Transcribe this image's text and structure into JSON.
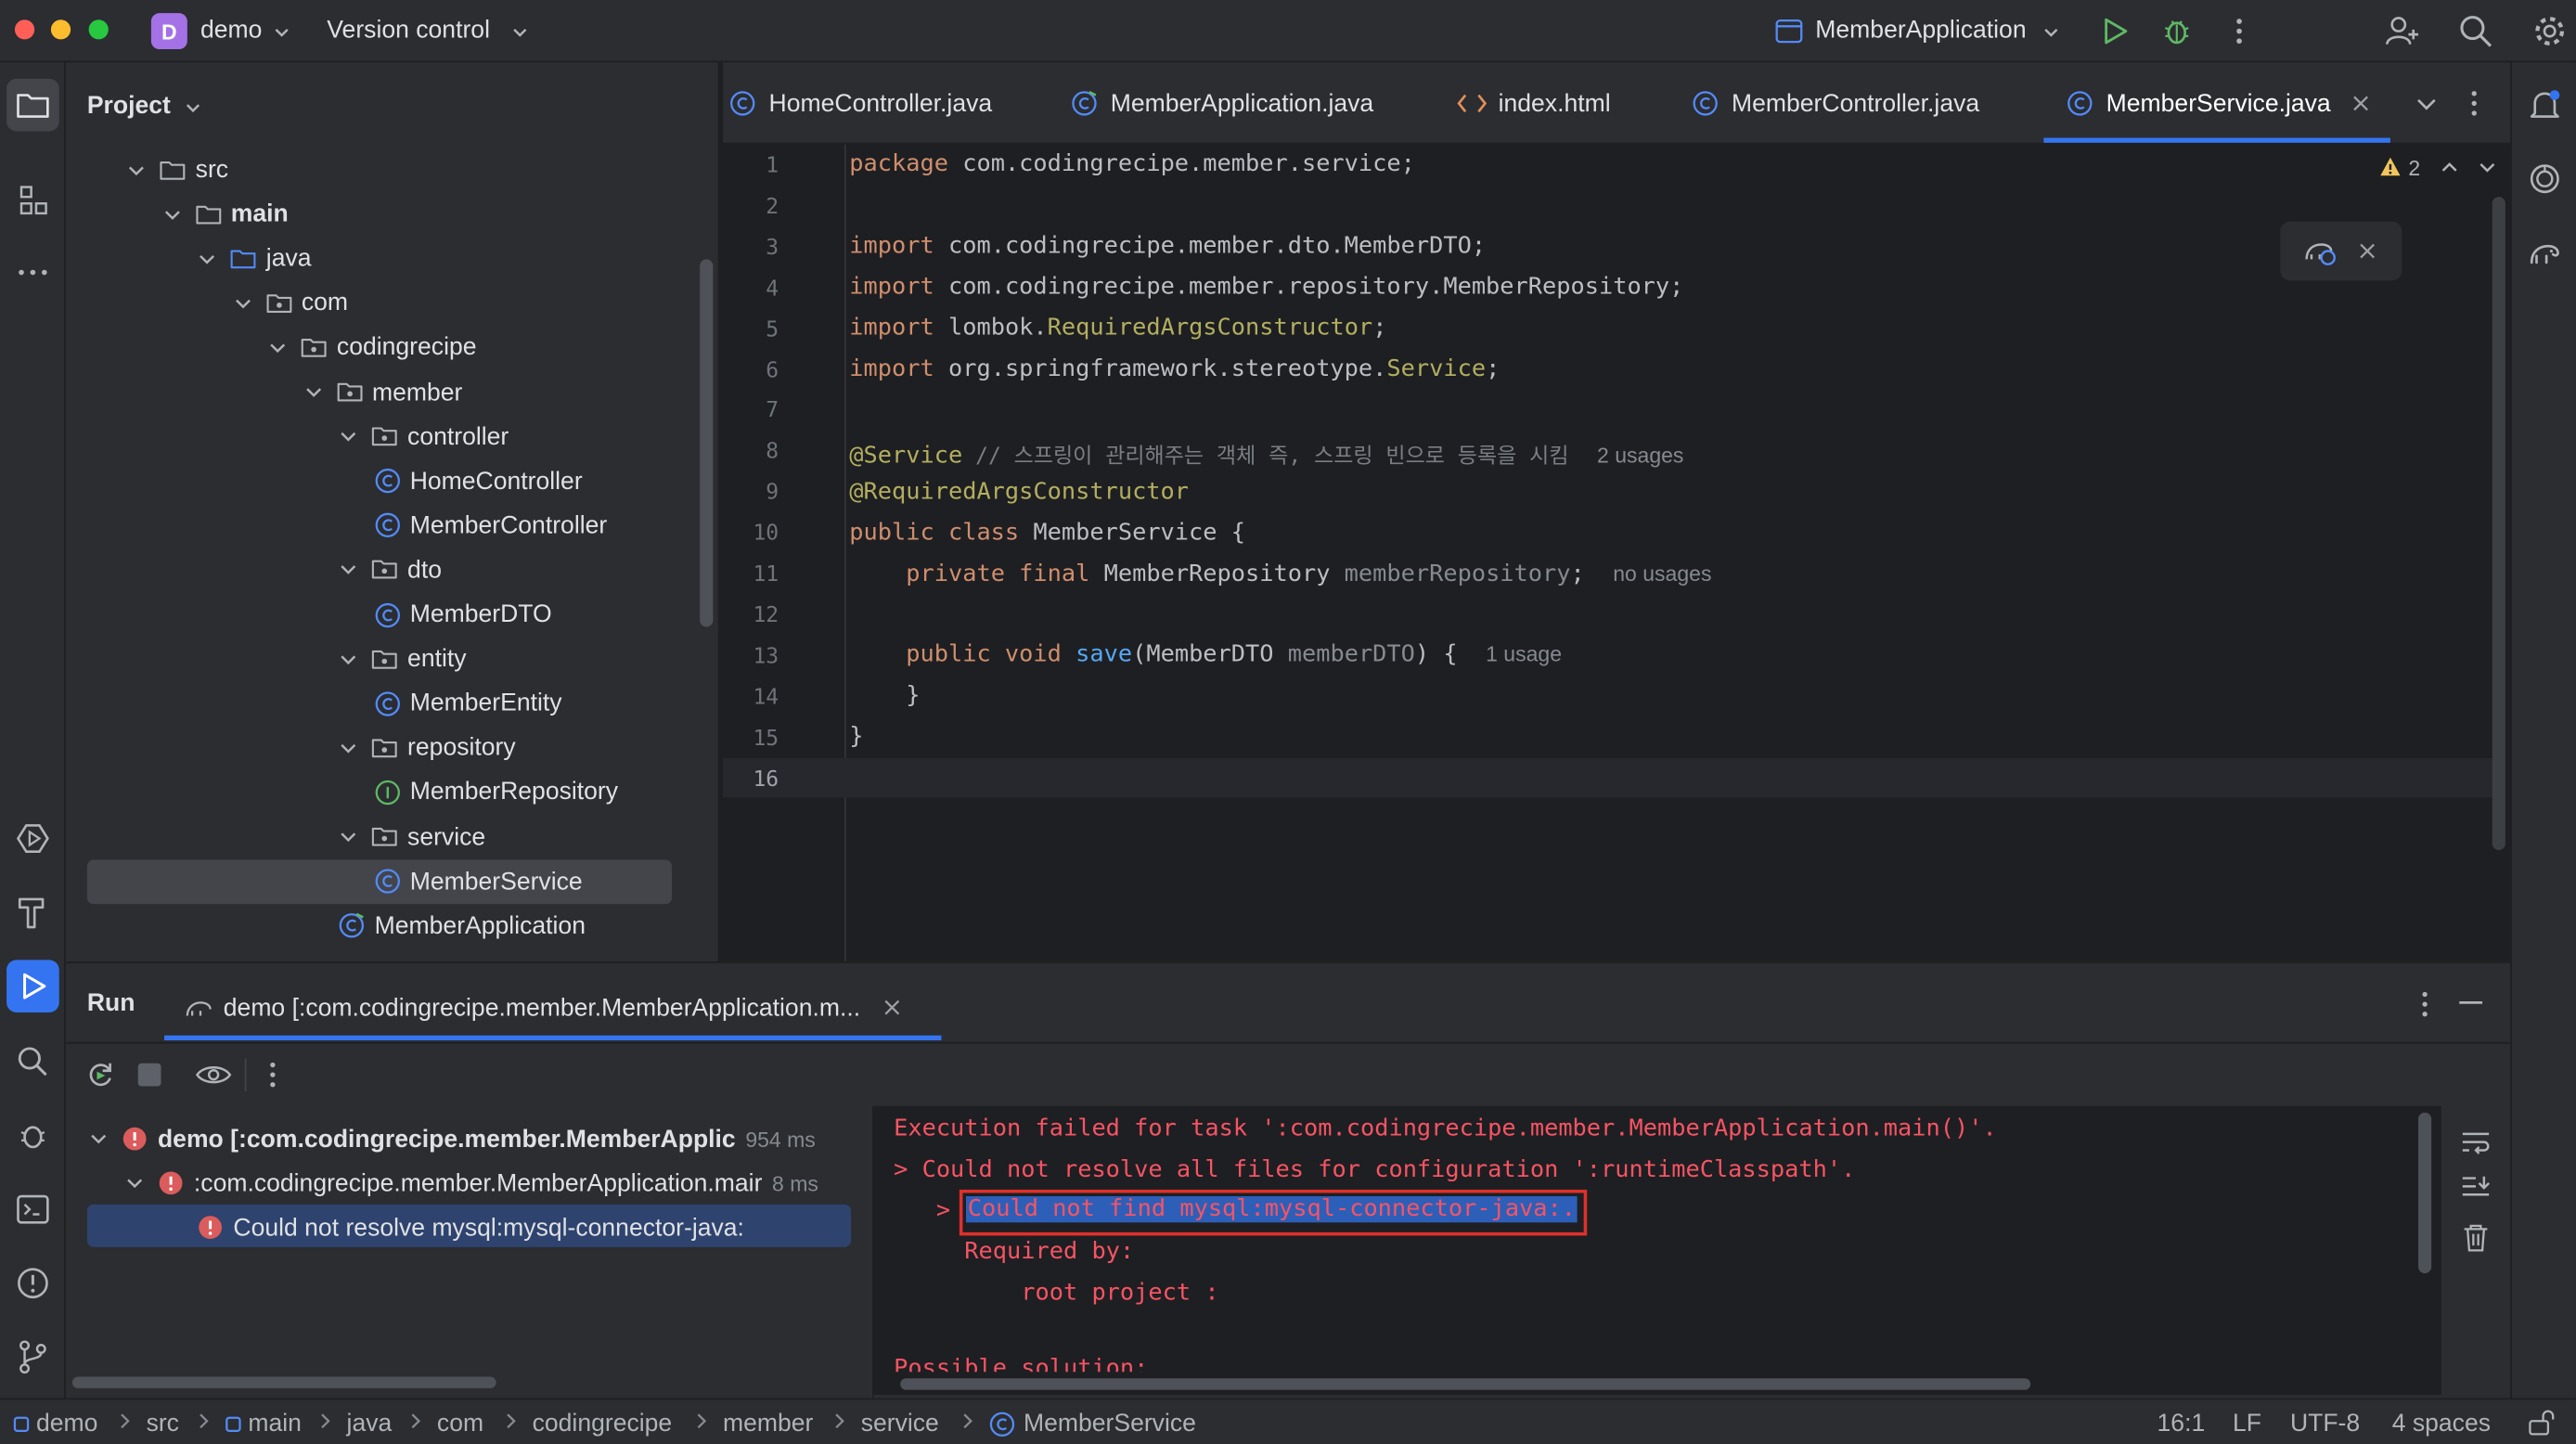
{
  "window": {
    "project_badge": "D",
    "project_name": "demo",
    "vcs": "Version control",
    "run_config": "MemberApplication"
  },
  "project_panel": {
    "title": "Project",
    "tree": [
      {
        "label": "src",
        "type": "folder",
        "level": 0
      },
      {
        "label": "main",
        "type": "folder",
        "level": 1,
        "bold": true
      },
      {
        "label": "java",
        "type": "folder-src",
        "level": 2
      },
      {
        "label": "com",
        "type": "package",
        "level": 3
      },
      {
        "label": "codingrecipe",
        "type": "package",
        "level": 4
      },
      {
        "label": "member",
        "type": "package",
        "level": 5
      },
      {
        "label": "controller",
        "type": "package",
        "level": 6
      },
      {
        "label": "HomeController",
        "type": "class",
        "level": 7
      },
      {
        "label": "MemberController",
        "type": "class",
        "level": 7
      },
      {
        "label": "dto",
        "type": "package",
        "level": 6
      },
      {
        "label": "MemberDTO",
        "type": "class",
        "level": 7
      },
      {
        "label": "entity",
        "type": "package",
        "level": 6
      },
      {
        "label": "MemberEntity",
        "type": "class",
        "level": 7
      },
      {
        "label": "repository",
        "type": "package",
        "level": 6
      },
      {
        "label": "MemberRepository",
        "type": "interface",
        "level": 7
      },
      {
        "label": "service",
        "type": "package",
        "level": 6
      },
      {
        "label": "MemberService",
        "type": "class",
        "level": 7,
        "selected": true
      },
      {
        "label": "MemberApplication",
        "type": "app",
        "level": 6
      }
    ]
  },
  "tabs": [
    {
      "label": "HomeController.java",
      "icon": "class-icon"
    },
    {
      "label": "MemberApplication.java",
      "icon": "app-class-icon"
    },
    {
      "label": "index.html",
      "icon": "html-icon"
    },
    {
      "label": "MemberController.java",
      "icon": "class-icon"
    },
    {
      "label": "MemberService.java",
      "icon": "class-icon",
      "active": true
    }
  ],
  "editor": {
    "warning_count": "2",
    "line_numbers": [
      "1",
      "2",
      "3",
      "4",
      "5",
      "6",
      "7",
      "8",
      "9",
      "10",
      "11",
      "12",
      "13",
      "14",
      "15",
      "16"
    ],
    "lines": {
      "l1_kw": "package",
      "l1_rest": " com.codingrecipe.member.service;",
      "l3_kw": "import",
      "l3_rest": " com.codingrecipe.member.dto.MemberDTO;",
      "l4_kw": "import",
      "l4_rest": " com.codingrecipe.member.repository.MemberRepository;",
      "l5_kw": "import",
      "l5_pre": " lombok.",
      "l5_ann": "RequiredArgsConstructor",
      "l5_end": ";",
      "l6_kw": "import",
      "l6_pre": " org.springframework.stereotype.",
      "l6_ann": "Service",
      "l6_end": ";",
      "l8_ann": "@Service",
      "l8_cmt": " // 스프링이 관리해주는 객체 즉, 스프링 빈으로 등록을 시킴",
      "l8_hint": "2 usages",
      "l9_ann": "@RequiredArgsConstructor",
      "l10_kw": "public class",
      "l10_rest": " MemberService {",
      "l11_kw": "private final",
      "l11_type": " MemberRepository ",
      "l11_fld": "memberRepository",
      "l11_end": ";",
      "l11_hint": "no usages",
      "l13_kw": "public void",
      "l13_fn": "save",
      "l13_type": "(MemberDTO ",
      "l13_prm": "memberDTO",
      "l13_end": ") {",
      "l13_hint": "1 usage",
      "l14": "}",
      "l15": "}"
    }
  },
  "run_panel": {
    "title": "Run",
    "tab_label": "demo [:com.codingrecipe.member.MemberApplication.m...",
    "tree": [
      {
        "label": "demo [:com.codingrecipe.member.MemberApplic",
        "time": "954 ms"
      },
      {
        "label": ":com.codingrecipe.member.MemberApplication.mair",
        "time": "8 ms"
      },
      {
        "label": "Could not resolve mysql:mysql-connector-java:",
        "time": ""
      }
    ],
    "console": [
      "Execution failed for task ':com.codingrecipe.member.MemberApplication.main()'.",
      "> Could not resolve all files for configuration ':runtimeClasspath'.",
      "   > ",
      "Could not find mysql:mysql-connector-java:.",
      "     Required by:",
      "         root project :",
      "Possible solution:"
    ]
  },
  "status_bar": {
    "breadcrumbs": [
      "demo",
      "src",
      "main",
      "java",
      "com",
      "codingrecipe",
      "member",
      "service",
      "MemberService"
    ],
    "position": "16:1",
    "line_sep": "LF",
    "encoding": "UTF-8",
    "indent": "4 spaces"
  },
  "colors": {
    "accent": "#3574f0",
    "error": "#f75464",
    "run_green": "#5fb865",
    "keyword": "#cf8e6d",
    "annotation": "#b3ae60"
  }
}
